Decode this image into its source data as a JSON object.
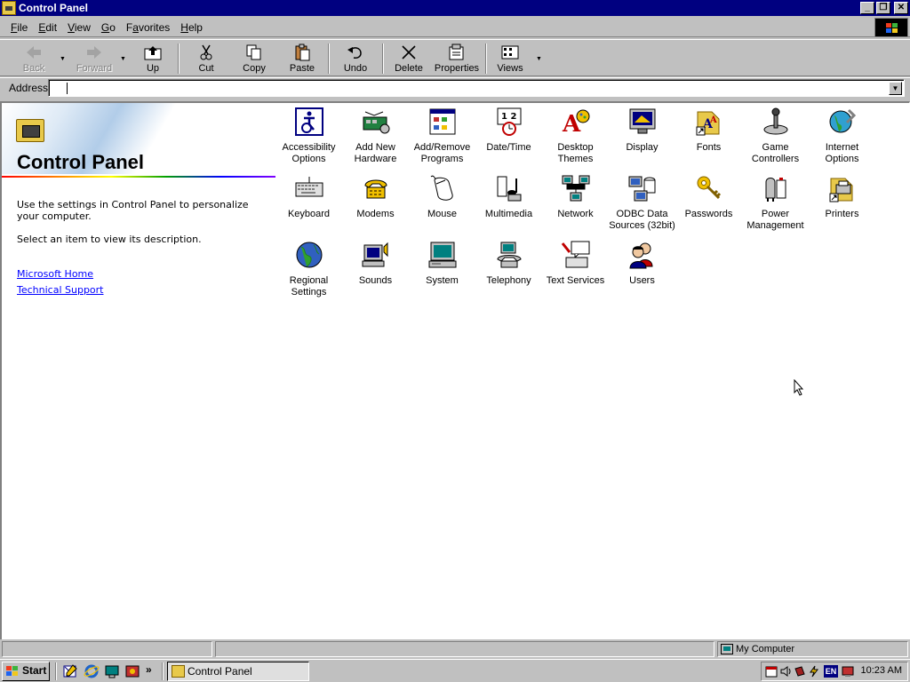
{
  "window": {
    "title": "Control Panel"
  },
  "menu": [
    "File",
    "Edit",
    "View",
    "Go",
    "Favorites",
    "Help"
  ],
  "menu_access_keys": [
    "F",
    "E",
    "V",
    "G",
    "a",
    "H"
  ],
  "toolbar": {
    "back": "Back",
    "forward": "Forward",
    "up": "Up",
    "cut": "Cut",
    "copy": "Copy",
    "paste": "Paste",
    "undo": "Undo",
    "delete": "Delete",
    "properties": "Properties",
    "views": "Views"
  },
  "address": {
    "label": "Address",
    "value": ""
  },
  "left_pane": {
    "title": "Control Panel",
    "description": "Use the settings in Control Panel to personalize your computer.",
    "hint": "Select an item to view its description.",
    "links": [
      "Microsoft Home",
      "Technical Support"
    ]
  },
  "items": [
    {
      "l1": "Accessibility",
      "l2": "Options",
      "icon": "accessibility-icon"
    },
    {
      "l1": "Add New",
      "l2": "Hardware",
      "icon": "add-hardware-icon"
    },
    {
      "l1": "Add/Remove",
      "l2": "Programs",
      "icon": "add-remove-programs-icon"
    },
    {
      "l1": "Date/Time",
      "l2": "",
      "icon": "date-time-icon"
    },
    {
      "l1": "Desktop",
      "l2": "Themes",
      "icon": "desktop-themes-icon"
    },
    {
      "l1": "Display",
      "l2": "",
      "icon": "display-icon"
    },
    {
      "l1": "Fonts",
      "l2": "",
      "icon": "fonts-icon"
    },
    {
      "l1": "Game",
      "l2": "Controllers",
      "icon": "game-controllers-icon"
    },
    {
      "l1": "Internet",
      "l2": "Options",
      "icon": "internet-options-icon"
    },
    {
      "l1": "Keyboard",
      "l2": "",
      "icon": "keyboard-icon"
    },
    {
      "l1": "Modems",
      "l2": "",
      "icon": "modems-icon"
    },
    {
      "l1": "Mouse",
      "l2": "",
      "icon": "mouse-icon"
    },
    {
      "l1": "Multimedia",
      "l2": "",
      "icon": "multimedia-icon"
    },
    {
      "l1": "Network",
      "l2": "",
      "icon": "network-icon"
    },
    {
      "l1": "ODBC Data",
      "l2": "Sources (32bit)",
      "icon": "odbc-icon"
    },
    {
      "l1": "Passwords",
      "l2": "",
      "icon": "passwords-icon"
    },
    {
      "l1": "Power",
      "l2": "Management",
      "icon": "power-management-icon"
    },
    {
      "l1": "Printers",
      "l2": "",
      "icon": "printers-icon"
    },
    {
      "l1": "Regional",
      "l2": "Settings",
      "icon": "regional-settings-icon"
    },
    {
      "l1": "Sounds",
      "l2": "",
      "icon": "sounds-icon"
    },
    {
      "l1": "System",
      "l2": "",
      "icon": "system-icon"
    },
    {
      "l1": "Telephony",
      "l2": "",
      "icon": "telephony-icon"
    },
    {
      "l1": "Text Services",
      "l2": "",
      "icon": "text-services-icon"
    },
    {
      "l1": "Users",
      "l2": "",
      "icon": "users-icon"
    }
  ],
  "status": {
    "zone": "My Computer"
  },
  "taskbar": {
    "start": "Start",
    "task": "Control Panel",
    "lang": "EN",
    "clock": "10:23 AM"
  },
  "colors": {
    "titlebar": "#000080",
    "face": "#c0c0c0",
    "link": "#0000ff"
  }
}
